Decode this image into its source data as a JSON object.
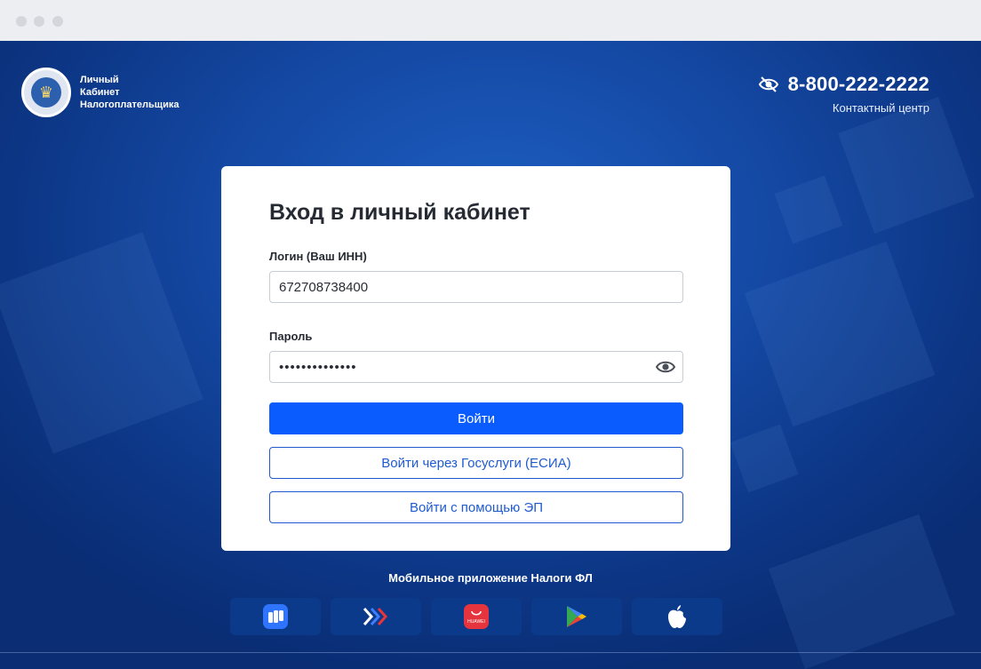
{
  "brand": {
    "line1": "Личный",
    "line2": "Кабинет",
    "line3": "Налогоплательщика"
  },
  "contact": {
    "phone": "8-800-222-2222",
    "caption": "Контактный центр"
  },
  "login": {
    "title": "Вход в личный кабинет",
    "login_label": "Логин (Ваш ИНН)",
    "login_value": "672708738400",
    "password_label": "Пароль",
    "password_value": "••••••••••••••",
    "submit": "Войти",
    "gosuslugi": "Войти через Госуслуги (ЕСИА)",
    "ep": "Войти с помощью ЭП"
  },
  "apps": {
    "title": "Мобильное приложение Налоги ФЛ",
    "stores": [
      "rustore-icon",
      "nashstore-icon",
      "huawei-appgallery-icon",
      "google-play-icon",
      "apple-appstore-icon"
    ],
    "huawei_text": "HUAWEI"
  },
  "colors": {
    "primary": "#0a5cff",
    "background": "#1448a3"
  }
}
